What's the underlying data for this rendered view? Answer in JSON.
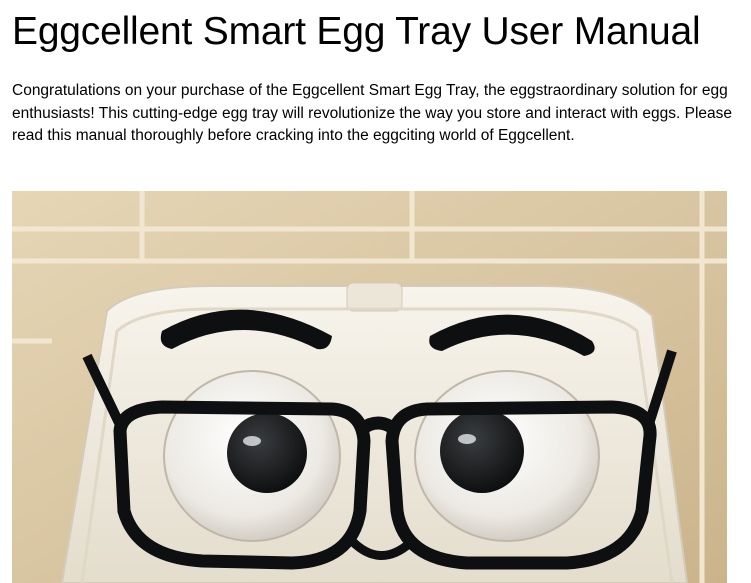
{
  "document": {
    "title": "Eggcellent Smart Egg Tray User Manual",
    "intro": "Congratulations on your purchase of the Eggcellent Smart Egg Tray, the eggstraordinary solution for egg enthusiasts! This cutting-edge egg tray will revolutionize the way you store and interact with eggs. Please read this manual thoroughly before cracking into the eggciting world of Eggcellent."
  },
  "photo": {
    "subject": "egg tray with cartoon face wearing black glasses",
    "colors": {
      "tile": "#d8c5a1",
      "grout": "#efe4cc",
      "tray": "#f2eee4",
      "frames": "#0d0f10",
      "pupil": "#111315"
    }
  }
}
